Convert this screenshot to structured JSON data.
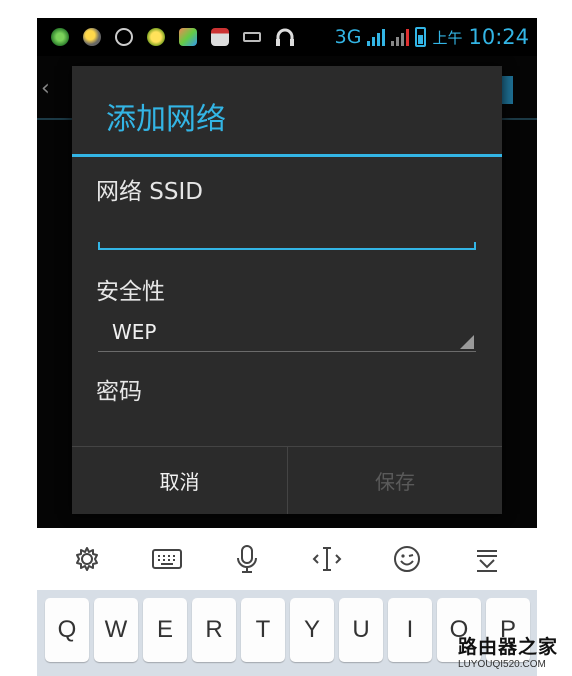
{
  "status_bar": {
    "icons": [
      "app-icon-1",
      "weather-icon",
      "app-icon-3",
      "app-icon-4",
      "app-icon-5",
      "calendar-icon",
      "keyboard-icon",
      "headphones-icon"
    ],
    "network": "3G",
    "am_pm": "上午",
    "time": "10:24",
    "colors": {
      "accent": "#33b5e5",
      "signal_red": "#e03030"
    }
  },
  "background": {
    "back_glyph": "‹"
  },
  "dialog": {
    "title": "添加网络",
    "ssid_label": "网络 SSID",
    "ssid_value": "",
    "security_label": "安全性",
    "security_value": "WEP",
    "password_label": "密码",
    "cancel_label": "取消",
    "save_label": "保存"
  },
  "keyboard_toolbar": {
    "icons": [
      "settings-icon",
      "keyboard-icon",
      "microphone-icon",
      "cursor-move-icon",
      "emoji-icon",
      "hide-keyboard-icon"
    ]
  },
  "keyboard": {
    "keys": [
      "Q",
      "W",
      "E",
      "R",
      "T",
      "Y",
      "U",
      "I",
      "O",
      "P"
    ]
  },
  "watermark": {
    "cn": "路由器之家",
    "en": "LUYOUQI520.COM"
  }
}
